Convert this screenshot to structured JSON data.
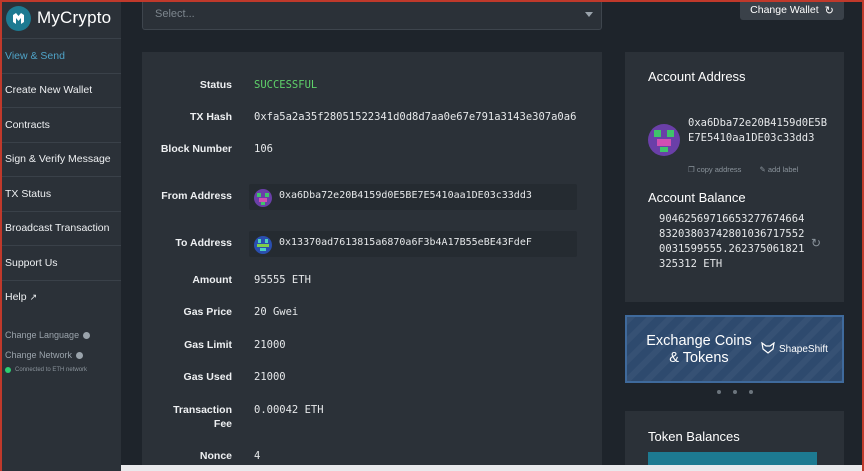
{
  "app": {
    "name": "MyCrypto"
  },
  "sidebar": {
    "items": [
      {
        "label": "View & Send",
        "active": true
      },
      {
        "label": "Create New Wallet"
      },
      {
        "label": "Contracts"
      },
      {
        "label": "Sign & Verify Message"
      },
      {
        "label": "TX Status"
      },
      {
        "label": "Broadcast Transaction"
      },
      {
        "label": "Support Us"
      },
      {
        "label": "Help"
      }
    ],
    "change_language": "Change Language",
    "change_network": "Change Network",
    "network_status": "Connected to ETH network"
  },
  "header": {
    "select_placeholder": "Select...",
    "change_wallet_label": "Change Wallet"
  },
  "transaction": {
    "status_label": "Status",
    "status": "SUCCESSFUL",
    "hash_label": "TX Hash",
    "hash": "0xfa5a2a35f28051522341d0d8d7aa0e67e791a3143e307a0a6",
    "block_label": "Block Number",
    "block": "106",
    "from_label": "From Address",
    "from": "0xa6Dba72e20B4159d0E5BE7E5410aa1DE03c33dd3",
    "to_label": "To Address",
    "to": "0x13370ad7613815a6870a6F3b4A17B55eBE43FdeF",
    "amount_label": "Amount",
    "amount": "95555 ETH",
    "gas_price_label": "Gas Price",
    "gas_price": "20 Gwei",
    "gas_limit_label": "Gas Limit",
    "gas_limit": "21000",
    "gas_used_label": "Gas Used",
    "gas_used": "21000",
    "fee_label": "Transaction Fee",
    "fee": "0.00042 ETH",
    "nonce_label": "Nonce",
    "nonce": "4"
  },
  "account": {
    "title": "Account Address",
    "address": "0xa6Dba72e20B4159d0E5BE7E5410aa1DE03c33dd3",
    "copy_label": "copy address",
    "add_label": "add label",
    "balance_title": "Account Balance",
    "balance": "90462569716653277674664832038037428010367175520031599555.262375061821325312 ETH"
  },
  "exchange": {
    "title": "Exchange Coins & Tokens",
    "brand": "ShapeShift"
  },
  "tokens": {
    "title": "Token Balances"
  },
  "colors": {
    "accent": "#1d7a91",
    "success": "#5fd16a",
    "link": "#4fa3c7"
  }
}
